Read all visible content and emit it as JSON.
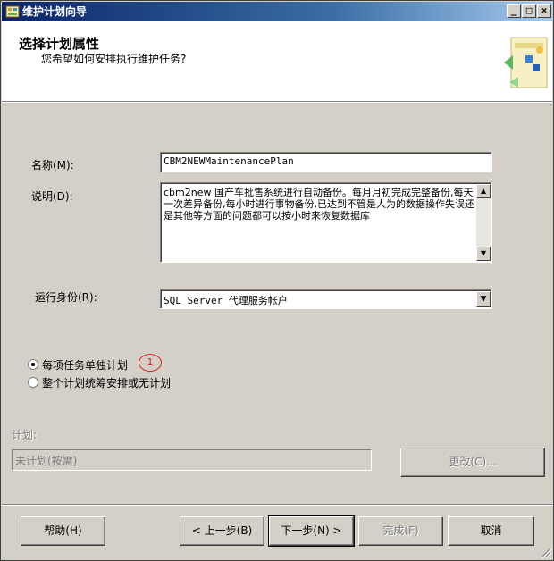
{
  "window": {
    "title": "维护计划向导"
  },
  "header": {
    "title": "选择计划属性",
    "subtitle": "您希望如何安排执行维护任务?"
  },
  "form": {
    "name_label": "名称(M):",
    "name_value": "CBM2NEWMaintenancePlan",
    "desc_label": "说明(D):",
    "desc_value": "cbm2new 国产车批售系统进行自动备份。每月月初完成完整备份,每天一次差异备份,每小时进行事物备份,已达到不管是人为的数据操作失误还是其他等方面的问题都可以按小时来恢复数据库",
    "runas_label": "运行身份(R):",
    "runas_value": "SQL Server 代理服务帐户",
    "radio_separate": "每项任务单独计划",
    "radio_single": "整个计划统筹安排或无计划",
    "annotation": "1",
    "schedule_label": "计划:",
    "schedule_value": "未计划(按需)",
    "change_button": "更改(C)..."
  },
  "footer": {
    "help": "帮助(H)",
    "back": "< 上一步(B)",
    "next": "下一步(N) >",
    "finish": "完成(F)",
    "cancel": "取消"
  },
  "colors": {
    "dialog_bg": "#d4d0c8",
    "titlebar_start": "#0a246a",
    "annotation": "#dd2222"
  }
}
